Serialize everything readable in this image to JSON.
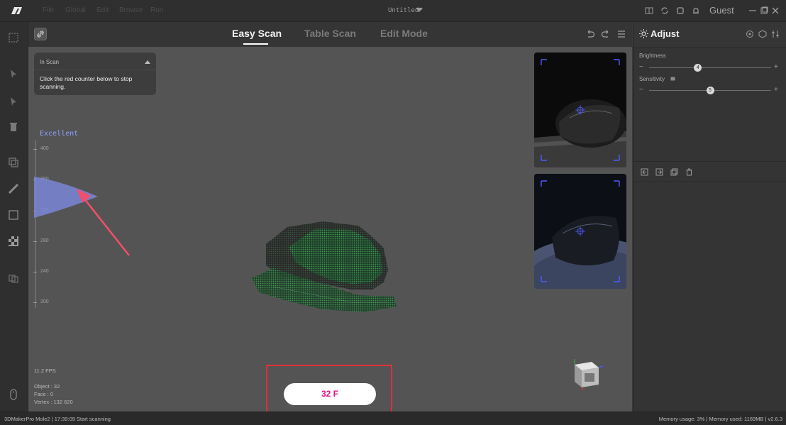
{
  "titlebar": {
    "menu": [
      "File",
      "Global",
      "Edit",
      "Browse",
      "Run"
    ],
    "document_title": "Untitled*",
    "user": "Guest"
  },
  "header": {
    "tabs": [
      {
        "label": "Easy Scan",
        "active": true
      },
      {
        "label": "Table Scan",
        "active": false
      },
      {
        "label": "Edit Mode",
        "active": false
      }
    ]
  },
  "scan_panel": {
    "title": "In Scan",
    "message": "Click the red counter below to stop scanning."
  },
  "distance_gauge": {
    "quality": "Excellent",
    "ticks": [
      "400",
      "360",
      "320",
      "280",
      "240",
      "200"
    ]
  },
  "stats": {
    "fps": "11.2 FPS",
    "object": "Object : 32",
    "face": "Face : 0",
    "vertex": "Vertex : 132 620"
  },
  "counter": {
    "label": "32 F"
  },
  "adjust": {
    "title": "Adjust",
    "brightness": {
      "label": "Brightness",
      "value": 4,
      "min": 0,
      "max": 10
    },
    "sensitivity": {
      "label": "Sensitivity",
      "value": 5,
      "min": 0,
      "max": 10
    },
    "minus": "−",
    "plus": "+"
  },
  "statusbar": {
    "left": "3DMakerPro Mole2  |  17:39:09 Start scanning",
    "right": "Memory usage: 3% | Memory used: 1169MB | v2.6.3"
  },
  "colors": {
    "accent": "#e3138a",
    "frame_red": "#e0303a",
    "gauge_blue": "#8fa1ff"
  }
}
